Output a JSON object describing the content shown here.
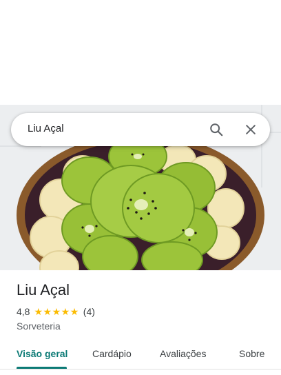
{
  "search": {
    "query": "Liu Açal"
  },
  "place": {
    "name": "Liu Açal",
    "rating": "4,8",
    "rating_value": 4.8,
    "review_count": "(4)",
    "category": "Sorveteria"
  },
  "tabs": [
    {
      "label": "Visão geral",
      "active": true
    },
    {
      "label": "Cardápio",
      "active": false
    },
    {
      "label": "Avaliações",
      "active": false
    },
    {
      "label": "Sobre",
      "active": false
    }
  ],
  "colors": {
    "accent": "#0b7a75",
    "star": "#fbbc04",
    "text_primary": "#202124",
    "text_secondary": "#5f6368"
  },
  "icons": {
    "search": "search-icon",
    "close": "close-icon",
    "star": "star-icon"
  }
}
